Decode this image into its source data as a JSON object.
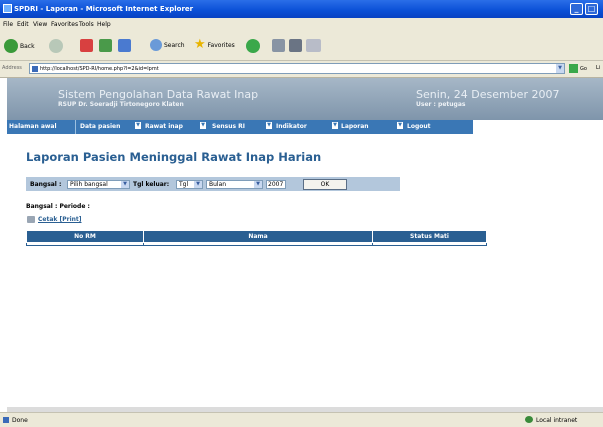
{
  "window": {
    "title": "SPDRI - Laporan - Microsoft Internet Explorer"
  },
  "menu": [
    "File",
    "Edit",
    "View",
    "Favorites",
    "Tools",
    "Help"
  ],
  "toolbar": {
    "back": "Back",
    "search": "Search",
    "favorites": "Favorites"
  },
  "address": {
    "label": "Address",
    "url": "http://localhost/SPD-RI/home.php?l=2&id=lpmt",
    "go": "Go",
    "links": "Li"
  },
  "header": {
    "title": "Sistem Pengolahan Data Rawat Inap",
    "subtitle": "RSUP Dr. Soeradji Tirtonegoro Klaten",
    "date": "Senin, 24 Desember 2007",
    "user": "User : petugas"
  },
  "nav": [
    "Halaman awal",
    "Data pasien",
    "Rawat inap",
    "Sensus RI",
    "Indikator",
    "Laporan",
    "Logout"
  ],
  "page": {
    "title": "Laporan Pasien Meninggal Rawat Inap Harian",
    "filter": {
      "bangsal_label": "Bangsal :",
      "bangsal_value": "Pilih bangsal",
      "tgl_label": "Tgl keluar:",
      "tgl_value": "Tgl",
      "bulan_value": "Bulan",
      "tahun_value": "2007",
      "ok": "OK"
    },
    "bangsal_periode": "Bangsal : Periode :",
    "cetak": "Cetak [Print]",
    "table": {
      "columns": [
        "No RM",
        "Nama",
        "Status Mati"
      ]
    }
  },
  "status": {
    "left": "Done",
    "right": "Local intranet"
  },
  "colors": {
    "titlebar": "#0a4fd6",
    "header": "#8fa4b9",
    "nav": "#3a77b5",
    "accent": "#2a5f92",
    "filterbar": "#b3c7dc"
  }
}
